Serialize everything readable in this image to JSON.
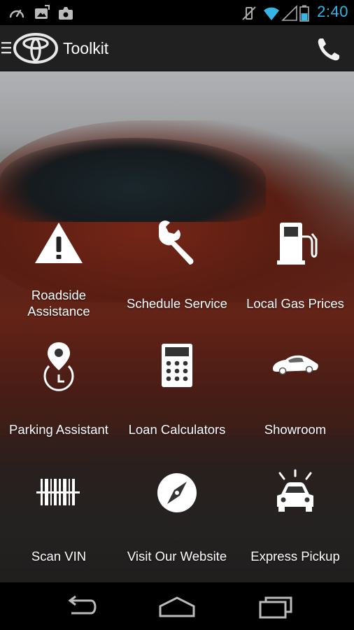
{
  "status_bar": {
    "time": "2:40",
    "icons_left": [
      "speedometer-icon",
      "image-upload-icon",
      "photo-upload-icon"
    ],
    "icons_right": [
      "vibrate-off-icon",
      "wifi-icon",
      "cell-signal-icon",
      "battery-icon"
    ]
  },
  "action_bar": {
    "title": "Toolkit",
    "left_icon": "menu-icon",
    "logo": "toyota-logo",
    "right_icon": "phone-icon"
  },
  "tools": [
    {
      "label": "Roadside Assistance",
      "icon": "warning-icon"
    },
    {
      "label": "Schedule Service",
      "icon": "wrench-icon"
    },
    {
      "label": "Local Gas Prices",
      "icon": "gas-pump-icon"
    },
    {
      "label": "Parking Assistant",
      "icon": "location-pin-timer-icon"
    },
    {
      "label": "Loan Calculators",
      "icon": "calculator-icon"
    },
    {
      "label": "Showroom",
      "icon": "car-side-icon"
    },
    {
      "label": "Scan VIN",
      "icon": "barcode-icon"
    },
    {
      "label": "Visit Our Website",
      "icon": "compass-icon"
    },
    {
      "label": "Express Pickup",
      "icon": "car-front-icon"
    }
  ],
  "nav_bar": {
    "buttons": [
      "back-icon",
      "home-icon",
      "recent-apps-icon"
    ]
  },
  "colors": {
    "status_time": "#35b5e5",
    "action_bar_bg": "#202020",
    "icon_white": "#ffffff"
  }
}
